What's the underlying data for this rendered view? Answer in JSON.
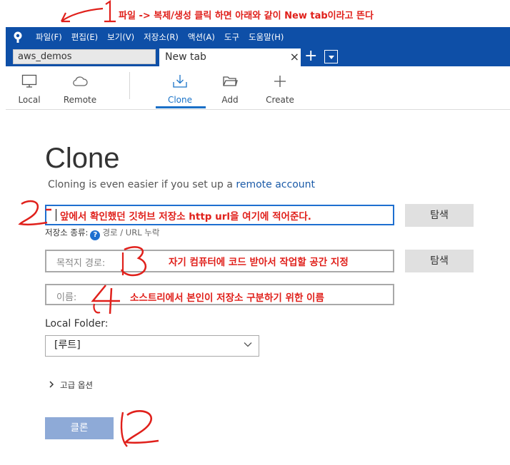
{
  "annotations": {
    "top": "파일 -> 복제/생성 클릭 하면 아래와 같이 New tab이라고 뜬다",
    "step2": "앞에서 확인했던 깃허브 저장소 http url을 여기에 적어준다.",
    "step3": "자기 컴퓨터에 코드 받아서 작업할 공간 지정",
    "step4": "소스트리에서 본인이 저장소 구분하기 위한 이름",
    "colors": {
      "ink": "#e0201b"
    }
  },
  "menubar": {
    "items": [
      "파일(F)",
      "편집(E)",
      "보기(V)",
      "저장소(R)",
      "액션(A)",
      "도구",
      "도움말(H)"
    ],
    "color": "#0e4fa7"
  },
  "tabs": {
    "items": [
      {
        "label": "aws_demos"
      },
      {
        "label": "New tab",
        "close": "×"
      }
    ],
    "add": "+"
  },
  "toolbar": {
    "local": "Local",
    "remote": "Remote",
    "clone": "Clone",
    "add": "Add",
    "create": "Create",
    "active_color": "#1a73c8"
  },
  "clone": {
    "title": "Clone",
    "subtitle_text": "Cloning is even easier if you set up a",
    "subtitle_link": "remote account",
    "browse1": "탐색",
    "hint_label": "저장소 종류:",
    "hint_icon": "?",
    "hint_value": "경로 / URL 누락",
    "dest_placeholder": "목적지 경로:",
    "browse2": "탐색",
    "name_placeholder": "이름:",
    "local_folder_label": "Local Folder:",
    "local_folder_value": "[루트]",
    "advanced": "고급 옵션",
    "clone_button": "클론",
    "button_color": "#8eaad7"
  }
}
